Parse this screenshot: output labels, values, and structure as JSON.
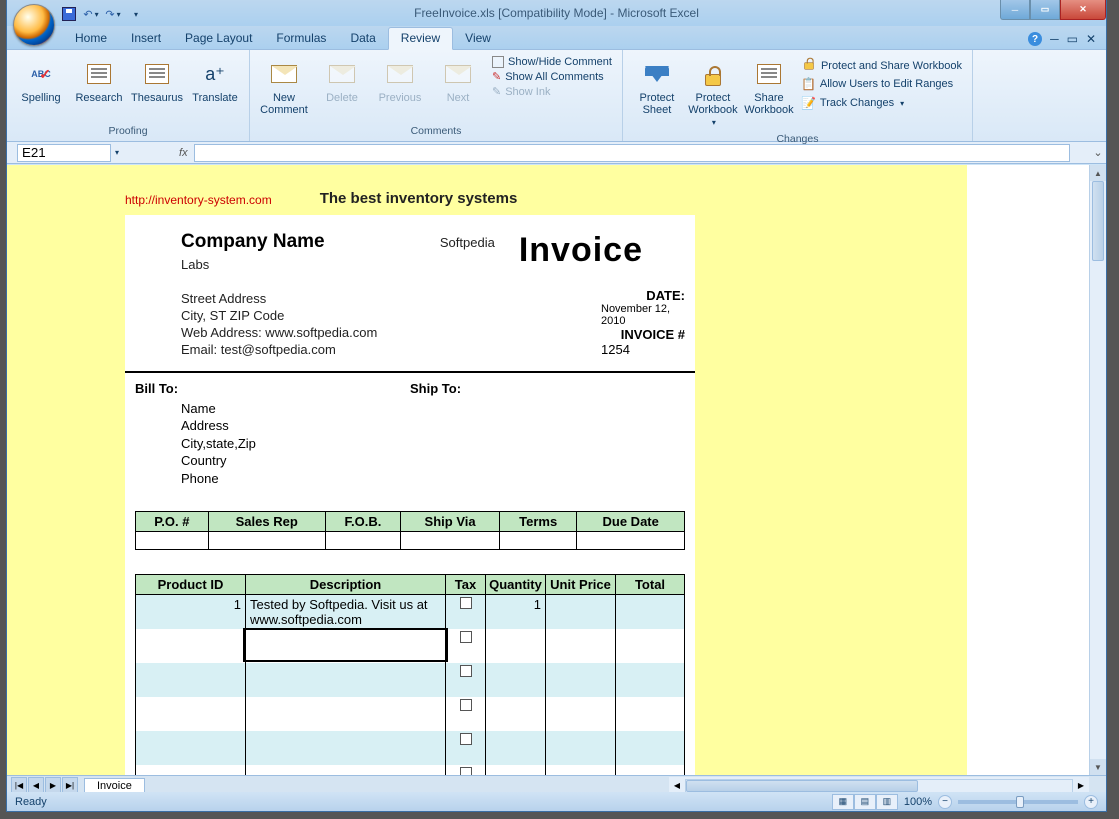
{
  "title": "FreeInvoice.xls  [Compatibility Mode] - Microsoft Excel",
  "tabs": {
    "home": "Home",
    "insert": "Insert",
    "page_layout": "Page Layout",
    "formulas": "Formulas",
    "data": "Data",
    "review": "Review",
    "view": "View"
  },
  "ribbon": {
    "proofing": {
      "label": "Proofing",
      "spelling": "Spelling",
      "research": "Research",
      "thesaurus": "Thesaurus",
      "translate": "Translate"
    },
    "comments": {
      "label": "Comments",
      "new": "New Comment",
      "delete": "Delete",
      "previous": "Previous",
      "next": "Next",
      "show_hide": "Show/Hide Comment",
      "show_all": "Show All Comments",
      "show_ink": "Show Ink"
    },
    "changes": {
      "label": "Changes",
      "protect_sheet": "Protect Sheet",
      "protect_wb": "Protect Workbook",
      "share_wb": "Share Workbook",
      "protect_share": "Protect and Share Workbook",
      "allow_users": "Allow Users to Edit Ranges",
      "track": "Track Changes"
    }
  },
  "namebox": "E21",
  "fx_label": "fx",
  "banner_link": "http://inventory-system.com",
  "banner_tag": "The best inventory systems",
  "company": {
    "name_label": "Company Name",
    "name_value": "Softpedia Labs",
    "street": "Street Address",
    "city": "City, ST  ZIP Code",
    "web": "Web Address: www.softpedia.com",
    "email": "Email: test@softpedia.com"
  },
  "invoice_title": "Invoice",
  "meta": {
    "date_label": "DATE:",
    "date_value": "November 12, 2010",
    "num_label": "INVOICE #",
    "num_value": "1254"
  },
  "billto": {
    "head": "Bill To:",
    "name": "Name",
    "address": "Address",
    "csz": "City,state,Zip",
    "country": "Country",
    "phone": "Phone"
  },
  "shipto": {
    "head": "Ship To:"
  },
  "t1_headers": [
    "P.O. #",
    "Sales Rep",
    "F.O.B.",
    "Ship Via",
    "Terms",
    "Due Date"
  ],
  "t2_headers": [
    "Product ID",
    "Description",
    "Tax",
    "Quantity",
    "Unit Price",
    "Total"
  ],
  "row1": {
    "pid": "1",
    "desc": "Tested by Softpedia. Visit us at www.softpedia.com",
    "qty": "1"
  },
  "sheet_tab": "Invoice",
  "status_ready": "Ready",
  "zoom": "100%"
}
